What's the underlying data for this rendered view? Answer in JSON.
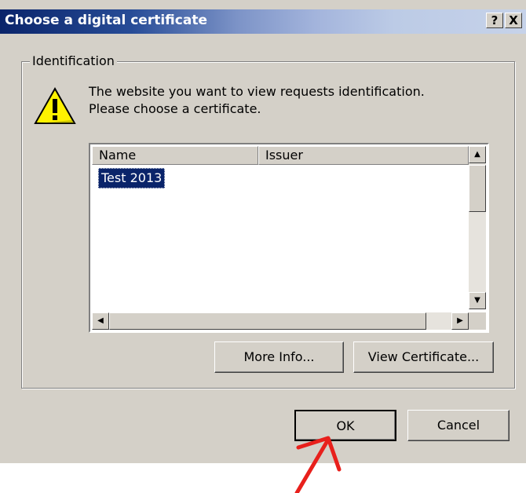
{
  "dialog": {
    "title": "Choose a digital certificate",
    "help_label": "?",
    "close_label": "X",
    "group_label": "Identification",
    "message_line1": "The website you want to view requests identification.",
    "message_line2": "Please choose a certificate."
  },
  "certificate_list": {
    "columns": [
      "Name",
      "Issuer"
    ],
    "rows": [
      {
        "name": "Test 2013",
        "issuer": "",
        "selected": true
      }
    ]
  },
  "buttons": {
    "more_info": "More Info...",
    "view_certificate": "View Certificate...",
    "ok": "OK",
    "cancel": "Cancel"
  },
  "icons": {
    "warning": "warning-icon",
    "annotation": "red-arrow-annotation"
  },
  "colors": {
    "title_start": "#0a246a",
    "selection": "#0a246a",
    "dialog_face": "#d4d0c8",
    "annotation": "#e8201c"
  }
}
